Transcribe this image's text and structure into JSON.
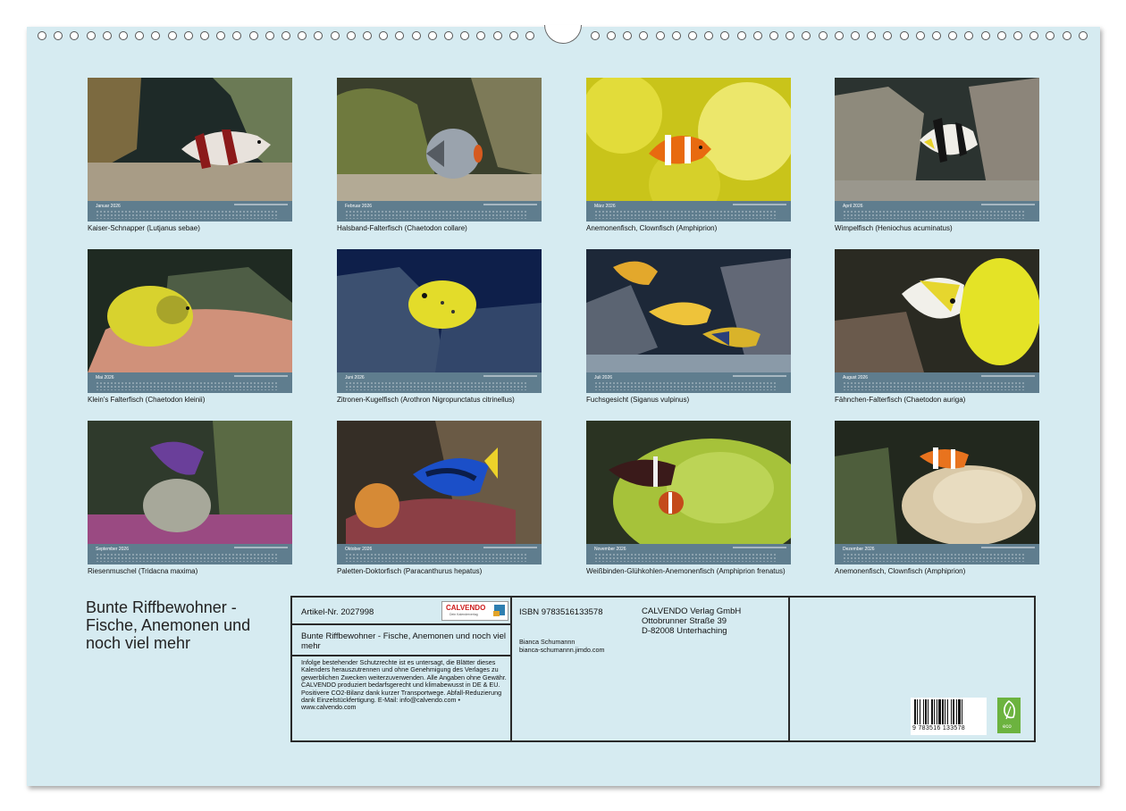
{
  "months": [
    {
      "month": "Januar 2026",
      "caption": "Kaiser-Schnapper (Lutjanus sebae)"
    },
    {
      "month": "Februar 2026",
      "caption": "Halsband-Falterfisch (Chaetodon collare)"
    },
    {
      "month": "März 2026",
      "caption": "Anemonenfisch, Clownfisch (Amphiprion)"
    },
    {
      "month": "April 2026",
      "caption": "Wimpelfisch (Heniochus acuminatus)"
    },
    {
      "month": "Mai 2026",
      "caption": "Klein's Falterfisch (Chaetodon kleinii)"
    },
    {
      "month": "Juni 2026",
      "caption": "Zitronen-Kugelfisch (Arothron Nigropunctatus citrinellus)"
    },
    {
      "month": "Juli 2026",
      "caption": "Fuchsgesicht (Siganus vulpinus)"
    },
    {
      "month": "August 2026",
      "caption": "Fähnchen-Falterfisch (Chaetodon auriga)"
    },
    {
      "month": "September 2026",
      "caption": "Riesenmuschel (Tridacna maxima)"
    },
    {
      "month": "Oktober 2026",
      "caption": "Paletten-Doktorfisch (Paracanthurus hepatus)"
    },
    {
      "month": "November 2026",
      "caption": "Weißbinden-Glühkohlen-Anemonenfisch (Amphiprion frenatus)"
    },
    {
      "month": "Dezember 2026",
      "caption": "Anemonenfisch, Clownfisch (Amphiprion)"
    }
  ],
  "title": "Bunte Riffbewohner - Fische, Anemonen und noch viel mehr",
  "imprint": {
    "article": "Artikel-Nr. 2027998",
    "logo_text": "CALVENDO",
    "logo_sub": "Dein Kalenderverlag",
    "product_title": "Bunte Riffbewohner - Fische, Anemonen und noch viel mehr",
    "legal": "Infolge bestehender Schutzrechte ist es untersagt, die Blätter dieses Kalenders herauszutrennen und ohne Genehmigung des Verlages zu gewerblichen Zwecken weiterzuverwenden. Alle Angaben ohne Gewähr. CALVENDO produziert bedarfsgerecht und klimabewusst in DE & EU. Positivere CO2-Bilanz dank kurzer Transportwege. Abfall-Reduzierung dank Einzelstückfertigung. E-Mail: info@calvendo.com • www.calvendo.com",
    "isbn": "ISBN 9783516133578",
    "author": "Bianca Schumannn",
    "website": "bianca-schumannn.jimdo.com",
    "publisher_line1": "CALVENDO Verlag GmbH",
    "publisher_line2": "Ottobrunner Straße 39",
    "publisher_line3": "D-82008 Unterhaching",
    "barcode_number": "9 783516 133578",
    "eco_label": "eco"
  }
}
